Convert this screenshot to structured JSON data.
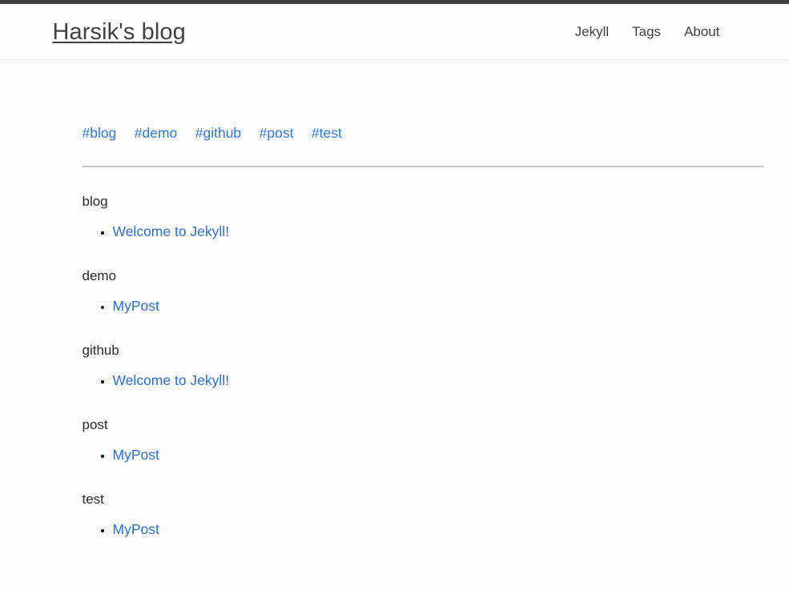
{
  "theme": {
    "accent_link": "#2a7ae2",
    "post_link": "#2a6fd0",
    "text": "#2b2b2b",
    "top_bar": "#424242",
    "background": "#fdfdfd",
    "divider": "#c8c8c8"
  },
  "header": {
    "site_title": "Harsik's blog",
    "nav": [
      {
        "label": "Jekyll",
        "name": "nav-link-jekyll"
      },
      {
        "label": "Tags",
        "name": "nav-link-tags"
      },
      {
        "label": "About",
        "name": "nav-link-about"
      }
    ]
  },
  "main": {
    "tag_cloud": [
      {
        "label": "#blog"
      },
      {
        "label": "#demo"
      },
      {
        "label": "#github"
      },
      {
        "label": "#post"
      },
      {
        "label": "#test"
      }
    ],
    "sections": [
      {
        "heading": "blog",
        "posts": [
          {
            "title": "Welcome to Jekyll!"
          }
        ]
      },
      {
        "heading": "demo",
        "posts": [
          {
            "title": "MyPost"
          }
        ]
      },
      {
        "heading": "github",
        "posts": [
          {
            "title": "Welcome to Jekyll!"
          }
        ]
      },
      {
        "heading": "post",
        "posts": [
          {
            "title": "MyPost"
          }
        ]
      },
      {
        "heading": "test",
        "posts": [
          {
            "title": "MyPost"
          }
        ]
      }
    ]
  }
}
